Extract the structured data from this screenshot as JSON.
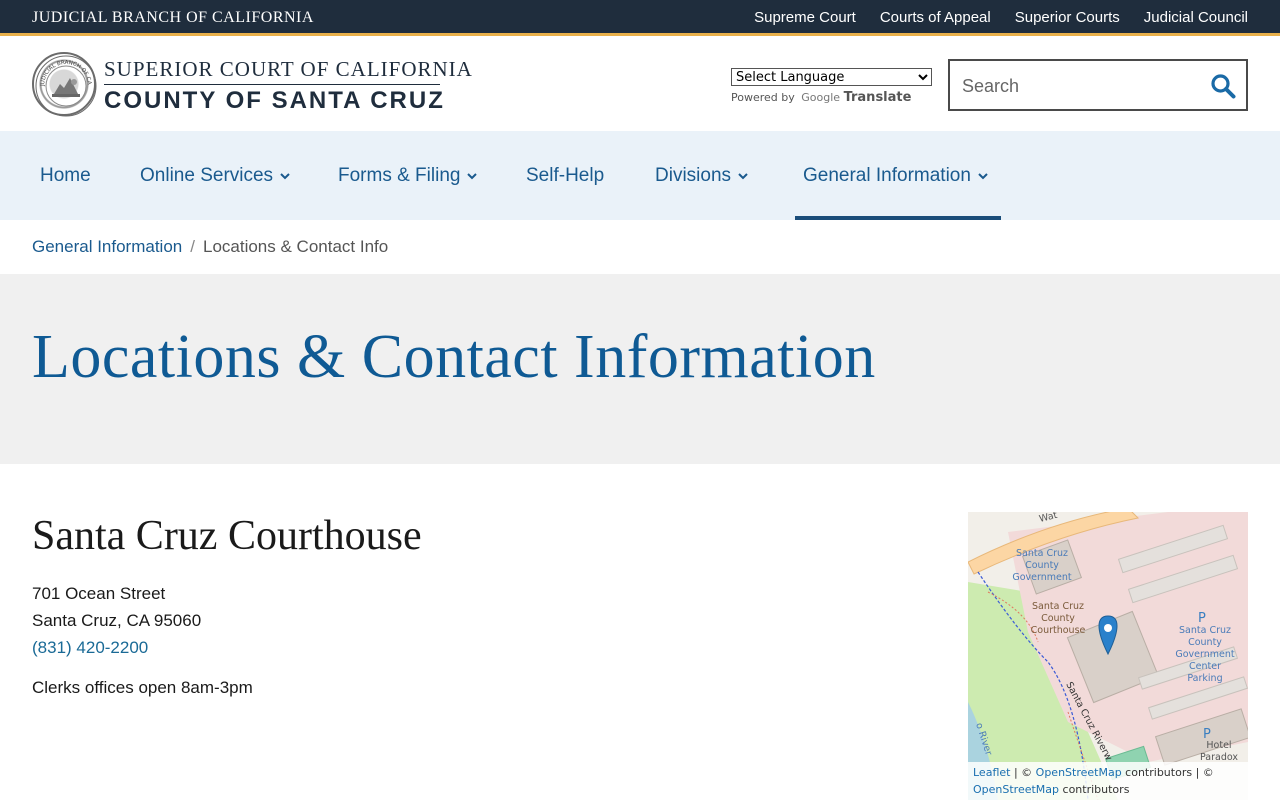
{
  "topbar": {
    "branch": "JUDICIAL BRANCH OF CALIFORNIA",
    "links": [
      "Supreme Court",
      "Courts of Appeal",
      "Superior Courts",
      "Judicial Council"
    ]
  },
  "header": {
    "line1": "SUPERIOR COURT OF CALIFORNIA",
    "line2": "COUNTY OF SANTA CRUZ",
    "seal_text": "JUDICIAL BRANCH OF CALIFORNIA",
    "language_select": "Select Language",
    "powered_by": "Powered by",
    "google": "Google",
    "translate": "Translate",
    "search_placeholder": "Search"
  },
  "nav": {
    "items": [
      {
        "label": "Home",
        "dropdown": false
      },
      {
        "label": "Online Services",
        "dropdown": true
      },
      {
        "label": "Forms & Filing",
        "dropdown": true
      },
      {
        "label": "Self-Help",
        "dropdown": false
      },
      {
        "label": "Divisions",
        "dropdown": true
      },
      {
        "label": "General Information",
        "dropdown": true,
        "active": true
      }
    ]
  },
  "breadcrumb": {
    "parent": "General Information",
    "separator": "/",
    "current": "Locations & Contact Info"
  },
  "page": {
    "title": "Locations & Contact Information"
  },
  "location": {
    "name": "Santa Cruz Courthouse",
    "street": "701 Ocean Street",
    "city": "Santa Cruz, CA 95060",
    "phone": "(831) 420-2200",
    "hours": "Clerks offices open 8am-3pm"
  },
  "map": {
    "labels": {
      "gov1": "Santa Cruz",
      "gov2": "County",
      "gov3": "Government",
      "court1": "Santa Cruz",
      "court2": "County",
      "court3": "Courthouse",
      "park1": "Santa Cruz",
      "park2": "County",
      "park3": "Government",
      "park4": "Center",
      "park5": "Parking",
      "hotel1": "Hotel",
      "hotel2": "Paradox",
      "riverwalk": "Santa Cruz Riverw",
      "river": "o River",
      "street": "Wat",
      "parking_p": "P"
    },
    "attribution": {
      "leaflet": "Leaflet",
      "sep1": " | © ",
      "osm1": "OpenStreetMap",
      "contrib1": " contributors | ©",
      "osm2": "OpenStreetMap",
      "contrib2": " contributors"
    }
  },
  "colors": {
    "topbar": "#1f2d3d",
    "accent_gold": "#e8b04a",
    "nav_bg": "#eaf2f9",
    "link_blue": "#1a5a8e",
    "title_blue": "#0f5a94",
    "title_band": "#f0f0f0"
  }
}
